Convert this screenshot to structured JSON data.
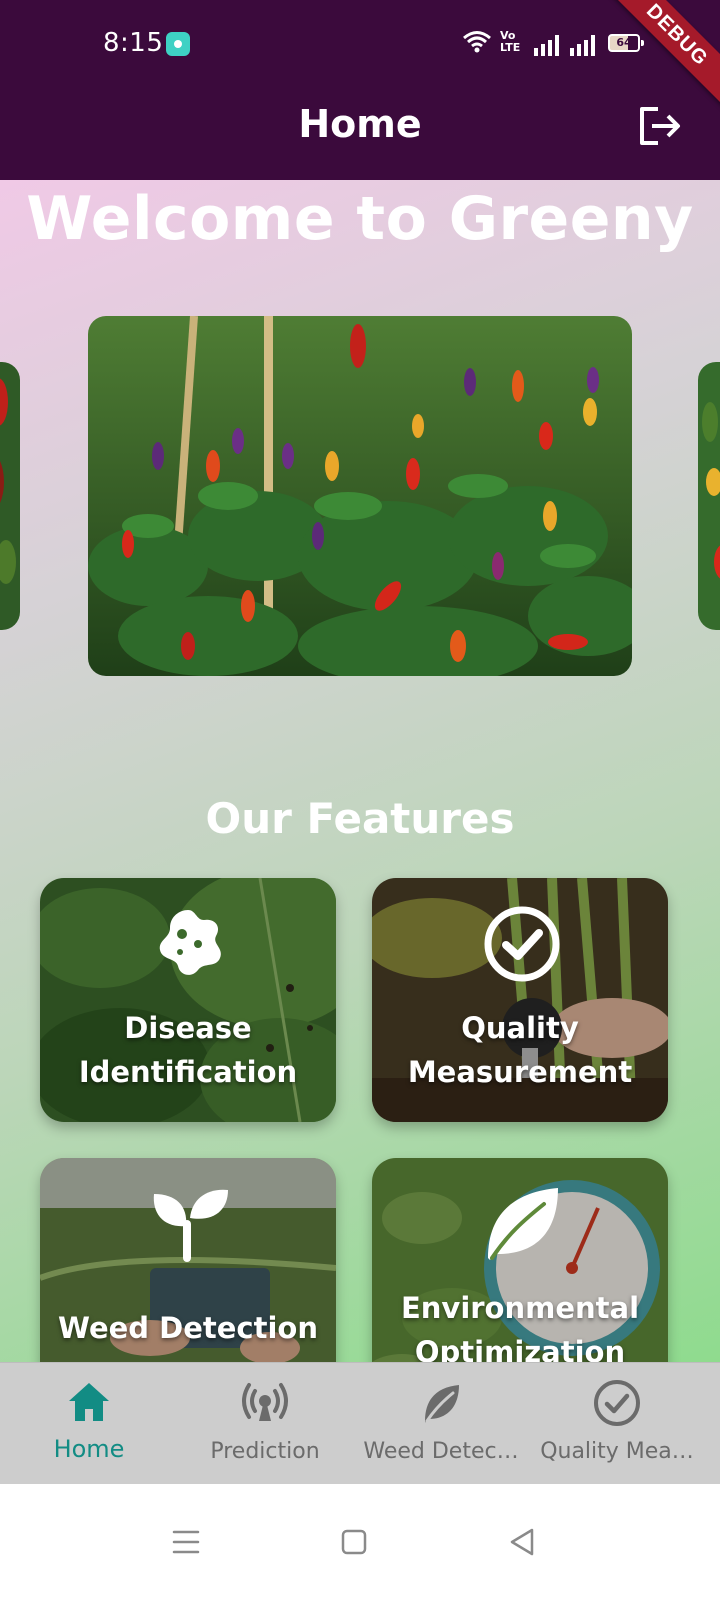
{
  "status_bar": {
    "time": "8:15",
    "battery": "64",
    "debug_banner": "DEBUG"
  },
  "app_bar": {
    "title": "Home",
    "logout_icon": "logout-icon"
  },
  "hero": {
    "title": "Welcome to Greeny",
    "carousel_image": "chili-pepper-plants"
  },
  "features": {
    "title": "Our Features",
    "cards": [
      {
        "icon": "germ-icon",
        "label_line1": "Disease",
        "label_line2": "Identification"
      },
      {
        "icon": "check-circle-icon",
        "label_line1": "Quality",
        "label_line2": "Measurement"
      },
      {
        "icon": "sprout-icon",
        "label_line1": "Weed Detection",
        "label_line2": ""
      },
      {
        "icon": "leaf-icon",
        "label_line1": "Environmental",
        "label_line2": "Optimization"
      }
    ]
  },
  "bottom_nav": {
    "items": [
      {
        "label": "Home",
        "icon": "home-icon",
        "active": true
      },
      {
        "label": "Prediction",
        "icon": "broadcast-icon",
        "active": false
      },
      {
        "label": "Weed Detec…",
        "icon": "leaf-icon",
        "active": false
      },
      {
        "label": "Quality Mea…",
        "icon": "check-circle-icon",
        "active": false
      }
    ]
  },
  "colors": {
    "app_bar": "#3b0a3c",
    "active_nav": "#128c84",
    "inactive_nav": "#6b6b6b",
    "debug_ribbon": "#a51a2a"
  }
}
